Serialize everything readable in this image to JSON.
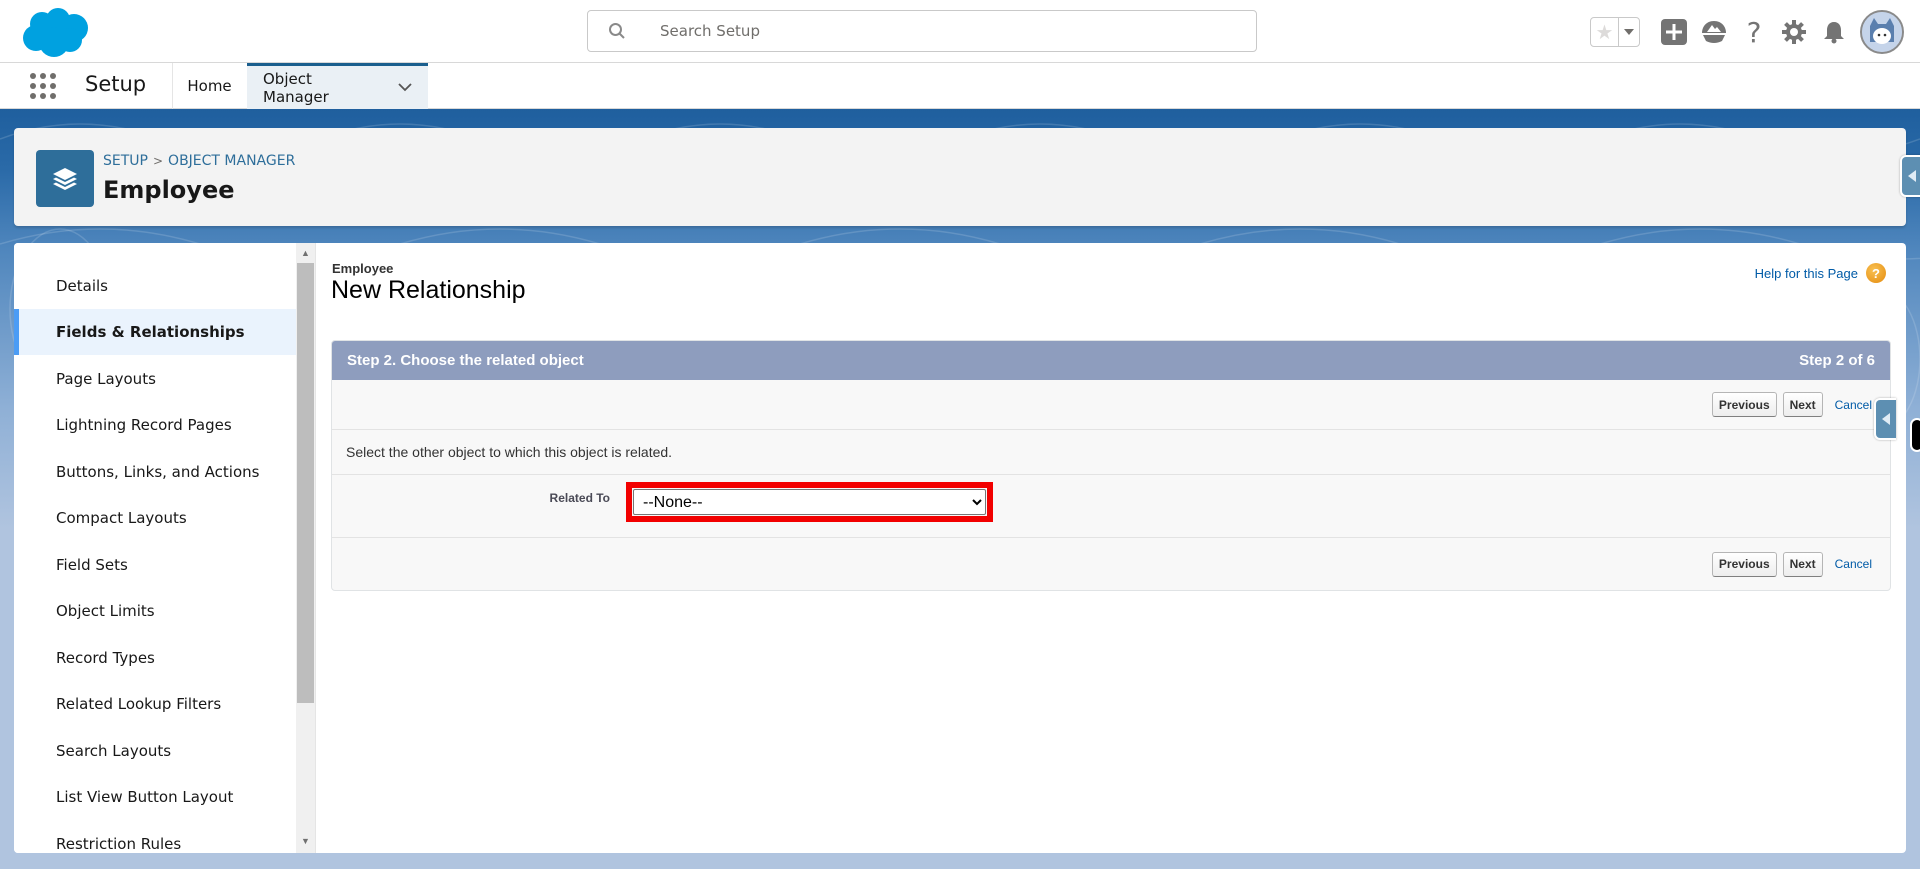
{
  "global_header": {
    "search": {
      "placeholder": "Search Setup",
      "value": ""
    },
    "icons": [
      "favorites-star-icon",
      "favorites-dropdown-icon",
      "global-actions-add-icon",
      "trailhead-icon",
      "help-icon",
      "setup-gear-icon",
      "notifications-bell-icon",
      "user-avatar"
    ]
  },
  "app_nav": {
    "app_name": "Setup",
    "tabs": [
      {
        "label": "Home",
        "active": false
      },
      {
        "label": "Object Manager",
        "active": true
      }
    ]
  },
  "object_header": {
    "breadcrumb": [
      "SETUP",
      "OBJECT MANAGER"
    ],
    "breadcrumb_separator": ">",
    "title": "Employee"
  },
  "sidebar": {
    "items": [
      {
        "label": "Details",
        "active": false
      },
      {
        "label": "Fields & Relationships",
        "active": true
      },
      {
        "label": "Page Layouts",
        "active": false
      },
      {
        "label": "Lightning Record Pages",
        "active": false
      },
      {
        "label": "Buttons, Links, and Actions",
        "active": false
      },
      {
        "label": "Compact Layouts",
        "active": false
      },
      {
        "label": "Field Sets",
        "active": false
      },
      {
        "label": "Object Limits",
        "active": false
      },
      {
        "label": "Record Types",
        "active": false
      },
      {
        "label": "Related Lookup Filters",
        "active": false
      },
      {
        "label": "Search Layouts",
        "active": false
      },
      {
        "label": "List View Button Layout",
        "active": false
      },
      {
        "label": "Restriction Rules",
        "active": false
      }
    ]
  },
  "content": {
    "page_type": "Employee",
    "page_title": "New Relationship",
    "help_link": "Help for this Page",
    "step": {
      "title": "Step 2. Choose the related object",
      "counter": "Step 2 of 6",
      "description": "Select the other object to which this object is related.",
      "buttons": {
        "previous": "Previous",
        "next": "Next",
        "cancel": "Cancel"
      },
      "field": {
        "label": "Related To",
        "selected_value": "--None--",
        "options": [
          "--None--"
        ]
      }
    }
  },
  "colors": {
    "brand_cloud": "#00a1e0",
    "step_bar": "#8e9dbe",
    "highlight": "#f20000",
    "link": "#015ba7",
    "active_indicator": "#4b9cf5",
    "object_icon": "#2e6e9a"
  }
}
